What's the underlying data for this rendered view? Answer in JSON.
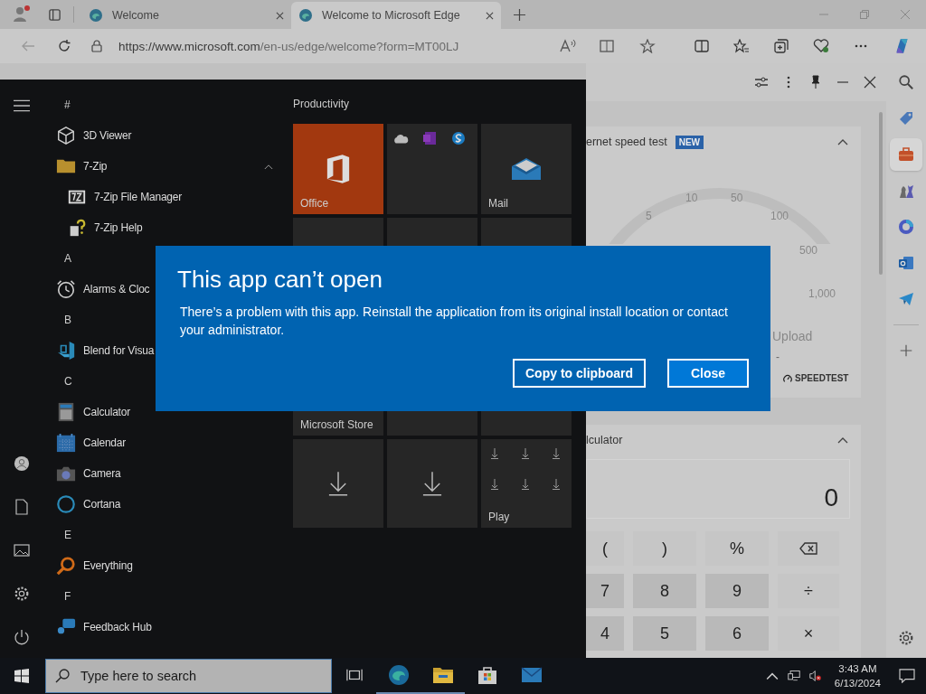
{
  "browser": {
    "tabs": [
      {
        "title": "Welcome",
        "selected": false
      },
      {
        "title": "Welcome to Microsoft Edge",
        "selected": true
      }
    ],
    "back_disabled": true,
    "url_host": "https://www.microsoft.com",
    "url_path": "/en-us/edge/welcome?form=MT00LJ"
  },
  "panel": {
    "speed_test": {
      "title": "ernet speed test",
      "badge": "NEW",
      "expanded": true,
      "scale": [
        "5",
        "10",
        "50",
        "100",
        "500",
        "1,000"
      ],
      "upload_label": "Upload",
      "upload_value": "-",
      "brand": "SPEEDTEST"
    },
    "calculator": {
      "title": "lculator",
      "expanded": true,
      "display": "0",
      "keys": [
        {
          "kind": "function",
          "label": "("
        },
        {
          "kind": "function",
          "label": ")"
        },
        {
          "kind": "function",
          "label": "%"
        },
        {
          "kind": "backspace"
        },
        {
          "kind": "digit",
          "label": "7"
        },
        {
          "kind": "digit",
          "label": "8"
        },
        {
          "kind": "digit",
          "label": "9"
        },
        {
          "kind": "function",
          "label": "÷"
        },
        {
          "kind": "digit",
          "label": "4"
        },
        {
          "kind": "digit",
          "label": "5"
        },
        {
          "kind": "digit",
          "label": "6"
        },
        {
          "kind": "function",
          "label": "×"
        }
      ]
    }
  },
  "sidebar": [
    {
      "selected": false
    },
    {
      "selected": true
    },
    {
      "selected": false
    },
    {
      "selected": false
    },
    {
      "selected": false
    },
    {
      "selected": false
    }
  ],
  "start_menu": {
    "list": [
      {
        "kind": "header",
        "label": "#"
      },
      {
        "kind": "app",
        "label": "3D Viewer"
      },
      {
        "kind": "folder",
        "label": "7-Zip",
        "expanded": true,
        "children": [
          {
            "kind": "app",
            "label": "7-Zip File Manager"
          },
          {
            "kind": "app",
            "label": "7-Zip Help"
          }
        ]
      },
      {
        "kind": "header",
        "label": "A"
      },
      {
        "kind": "app",
        "label": "Alarms & Cloc"
      },
      {
        "kind": "header",
        "label": "B"
      },
      {
        "kind": "app",
        "label": "Blend for Visua"
      },
      {
        "kind": "header",
        "label": "C"
      },
      {
        "kind": "app",
        "label": "Calculator"
      },
      {
        "kind": "app",
        "label": "Calendar"
      },
      {
        "kind": "app",
        "label": "Camera"
      },
      {
        "kind": "app",
        "label": "Cortana"
      },
      {
        "kind": "header",
        "label": "E"
      },
      {
        "kind": "app",
        "label": "Everything"
      },
      {
        "kind": "header",
        "label": "F"
      },
      {
        "kind": "app",
        "label": "Feedback Hub"
      }
    ],
    "group_title": "Productivity",
    "tiles": [
      {
        "label": "Office",
        "color": "#a2380f"
      },
      {
        "color": "#262626"
      },
      {
        "label": "Mail",
        "color": "#262626"
      },
      {
        "color": "#262626"
      },
      {
        "color": "#262626"
      },
      {
        "color": "#262626"
      },
      {
        "label": "Microsoft Store",
        "color": "#262626"
      },
      {
        "color": "#262626"
      },
      {
        "color": "#262626"
      },
      {
        "color": "#262626"
      },
      {
        "color": "#262626"
      },
      {
        "label": "Play",
        "color": "#262626"
      }
    ]
  },
  "dialog": {
    "title": "This app can’t open",
    "message": "There’s a problem with this app. Reinstall the application from its original install location or contact your administrator.",
    "buttons": [
      {
        "label": "Copy to clipboard",
        "default": false
      },
      {
        "label": "Close",
        "default": true
      }
    ]
  },
  "taskbar": {
    "search_placeholder": "Type here to search",
    "apps": [
      {
        "running": false
      },
      {
        "running": true
      },
      {
        "running": true
      },
      {
        "running": false
      },
      {
        "running": false
      }
    ],
    "time": "3:43 AM",
    "date": "6/13/2024"
  }
}
